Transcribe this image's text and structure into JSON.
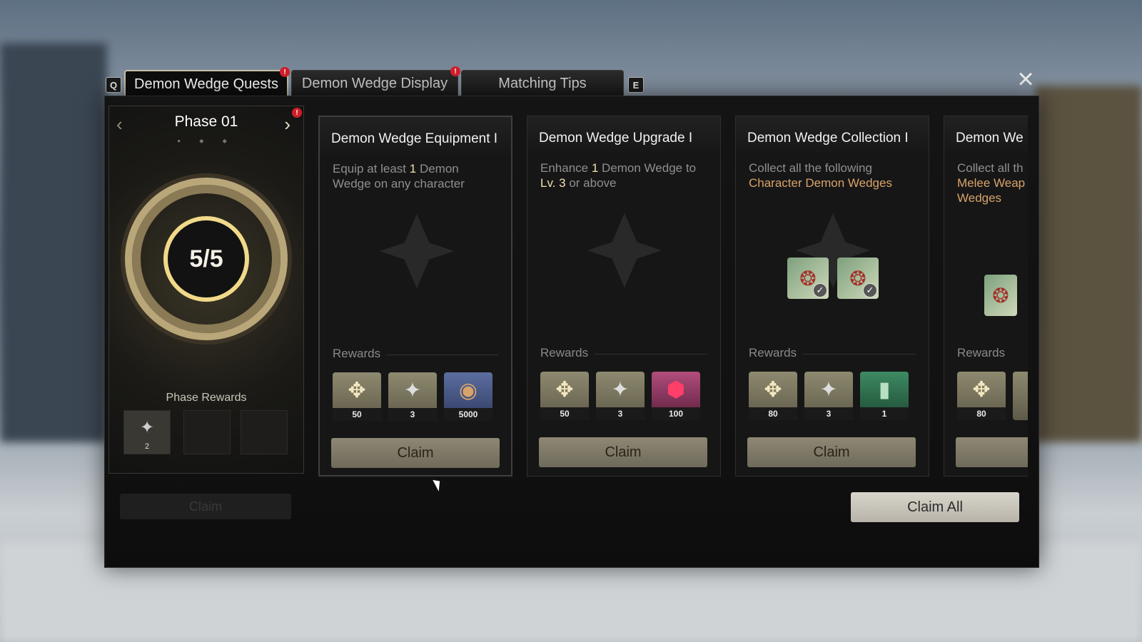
{
  "tabs": {
    "prev_key": "Q",
    "next_key": "E",
    "items": [
      {
        "label": "Demon Wedge Quests",
        "alert": "!"
      },
      {
        "label": "Demon Wedge Display",
        "alert": "!"
      },
      {
        "label": "Matching Tips"
      }
    ]
  },
  "close_icon": "close-icon",
  "phase": {
    "title": "Phase 01",
    "alert": "!",
    "progress": "5/5",
    "rewards_label": "Phase Rewards",
    "rewards": [
      {
        "count": "2"
      }
    ],
    "claim_label": "Claim"
  },
  "cards": [
    {
      "title": "Demon Wedge Equipment I",
      "desc_a": "Equip at least ",
      "desc_hl": "1",
      "desc_b": " Demon Wedge on any character",
      "rewards_label": "Rewards",
      "rewards": [
        {
          "count": "50"
        },
        {
          "count": "3"
        },
        {
          "count": "5000"
        }
      ],
      "claim_label": "Claim"
    },
    {
      "title": "Demon Wedge Upgrade I",
      "desc_a": "Enhance ",
      "desc_hl": "1",
      "desc_b": " Demon Wedge to ",
      "desc_hl2": "Lv. 3",
      "desc_c": " or above",
      "rewards_label": "Rewards",
      "rewards": [
        {
          "count": "50"
        },
        {
          "count": "3"
        },
        {
          "count": "100"
        }
      ],
      "claim_label": "Claim"
    },
    {
      "title": "Demon Wedge Collection I",
      "desc_a": "Collect all the following",
      "desc_hl": "Character Demon Wedges",
      "rewards_label": "Rewards",
      "rewards": [
        {
          "count": "80"
        },
        {
          "count": "3"
        },
        {
          "count": "1"
        }
      ],
      "claim_label": "Claim"
    },
    {
      "title": "Demon We",
      "desc_a": "Collect all th",
      "desc_hl": "Melee Weap",
      "desc_hl2": "Wedges",
      "rewards_label": "Rewards",
      "rewards": [
        {
          "count": "80"
        }
      ],
      "claim_label": "C"
    }
  ],
  "claim_all_label": "Claim All"
}
